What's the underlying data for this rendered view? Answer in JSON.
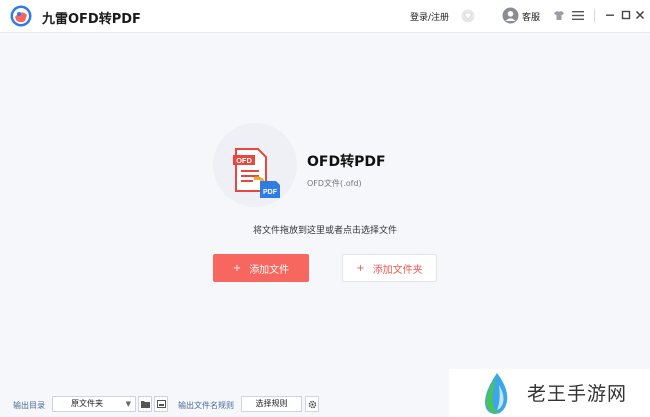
{
  "titlebar": {
    "title": "九雷OFD转PDF",
    "login_label": "登录/注册",
    "service_label": "客服",
    "icons": [
      "app-logo-icon",
      "diamond-vip-icon",
      "user-avatar-icon",
      "skin-icon",
      "menu-icon",
      "minimize-icon",
      "maximize-icon",
      "close-icon"
    ]
  },
  "main": {
    "conversion_title": "OFD转PDF",
    "conversion_subtitle": "OFD文件(.ofd)",
    "file_badge_top": "OFD",
    "file_badge_bottom": "PDF",
    "drop_hint": "将文件拖放到这里或者点击选择文件",
    "add_file_label": "添加文件",
    "add_folder_label": "添加文件夹",
    "plus": "+"
  },
  "bottom": {
    "output_dir_label": "输出目录",
    "output_dir_value": "原文件夹",
    "filename_rule_label": "输出文件名规则",
    "choose_rule_label": "选择规则"
  },
  "watermark": {
    "text": "老王手游网"
  },
  "colors": {
    "accent": "#f7675f",
    "accent_text": "#f05a52",
    "label_blue": "#4a6a9a",
    "background": "#f6f7fb"
  }
}
